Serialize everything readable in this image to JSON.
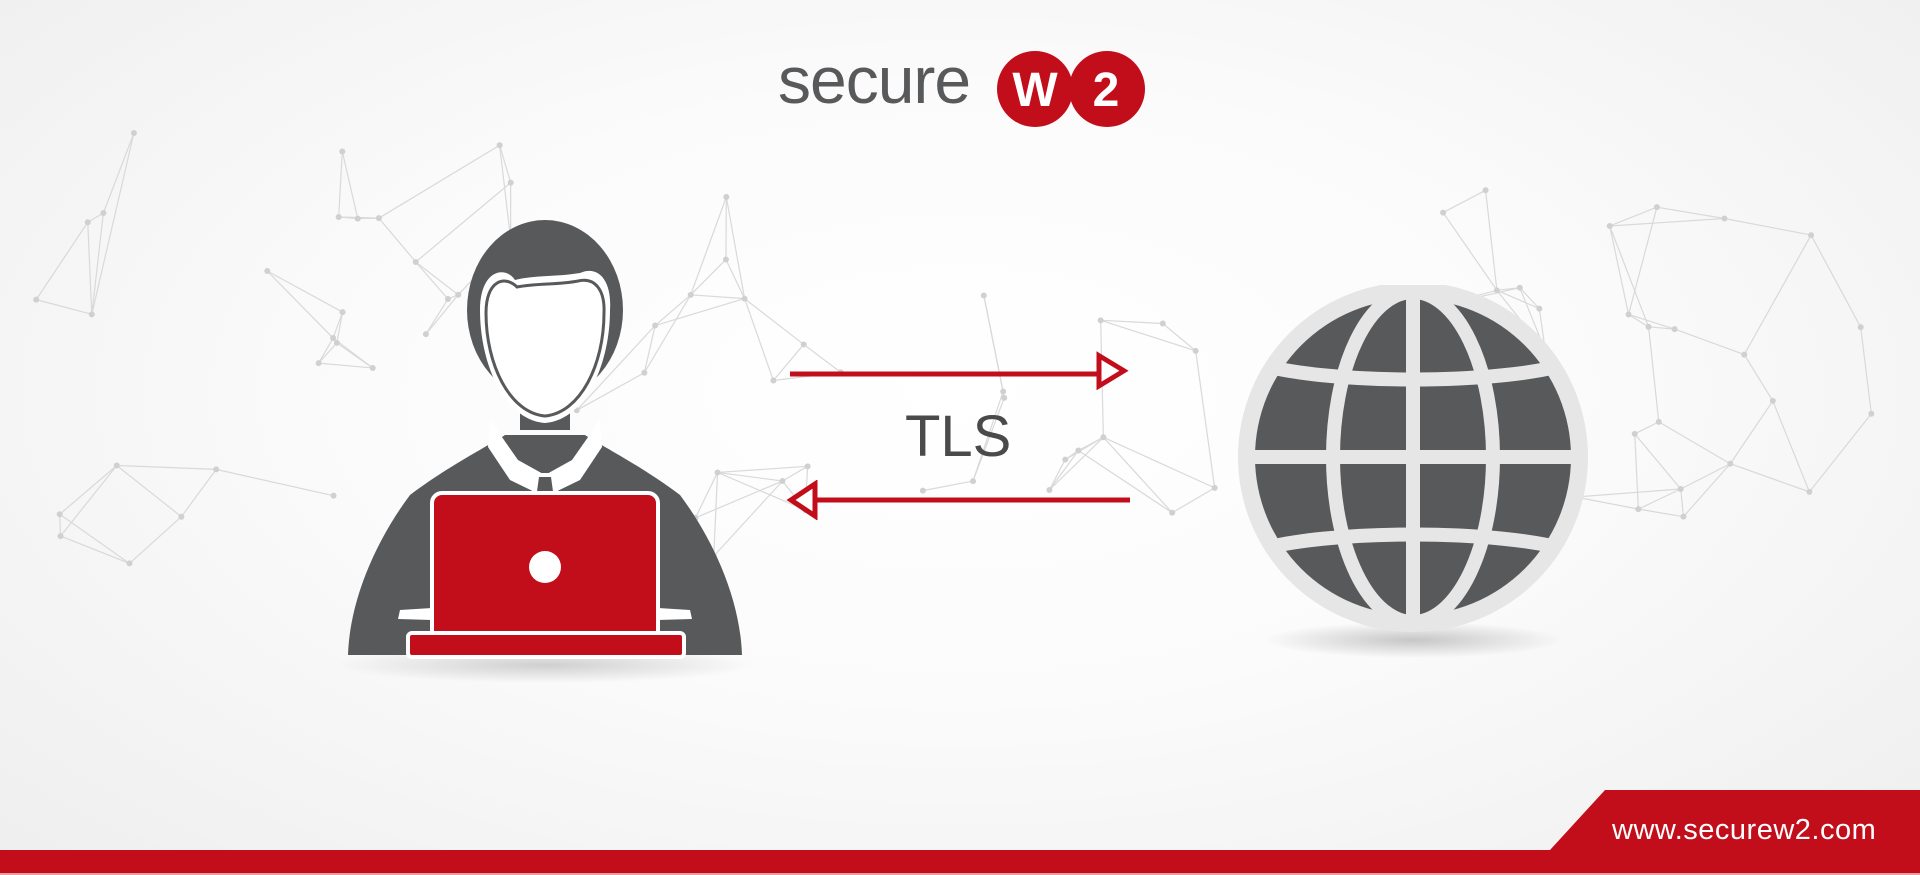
{
  "logo": {
    "text": "secure",
    "badge_letters": [
      "W",
      "2"
    ],
    "text_color": "#58595b",
    "badge_color": "#c20e1a"
  },
  "diagram": {
    "nodes": [
      {
        "id": "user-laptop",
        "label": "",
        "icon": "user-with-laptop-icon"
      },
      {
        "id": "internet",
        "label": "",
        "icon": "globe-icon"
      }
    ],
    "connection_label": "TLS",
    "edges": [
      {
        "from": "user-laptop",
        "to": "internet",
        "direction": "right"
      },
      {
        "from": "internet",
        "to": "user-laptop",
        "direction": "left"
      }
    ]
  },
  "footer": {
    "url": "www.securew2.com",
    "accent_color": "#c20e1a"
  },
  "colors": {
    "primary_red": "#c20e1a",
    "dark_gray": "#58595b",
    "light_gray": "#e6e6e6"
  }
}
